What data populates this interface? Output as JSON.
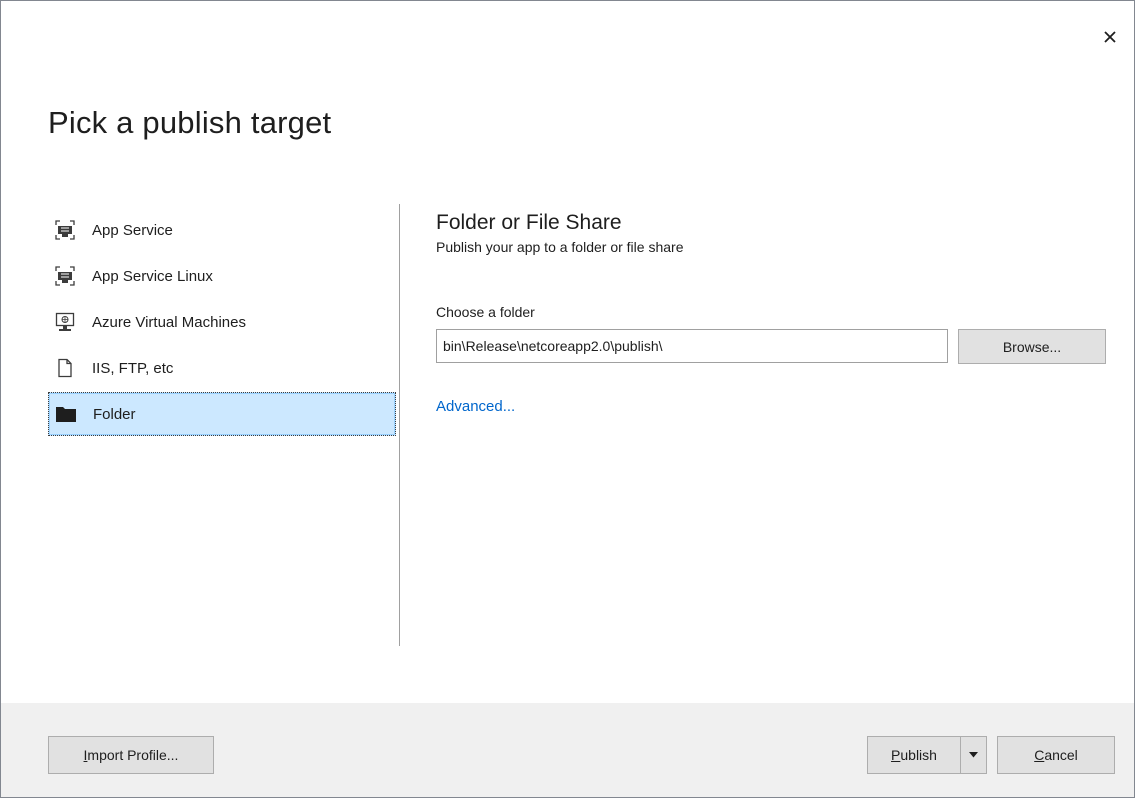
{
  "dialog": {
    "title": "Pick a publish target",
    "close_icon": "close-icon"
  },
  "targets": [
    {
      "label": "App Service",
      "icon": "app-service-icon",
      "selected": false
    },
    {
      "label": "App Service Linux",
      "icon": "app-service-linux-icon",
      "selected": false
    },
    {
      "label": "Azure Virtual Machines",
      "icon": "virtual-machine-icon",
      "selected": false
    },
    {
      "label": "IIS, FTP, etc",
      "icon": "document-icon",
      "selected": false
    },
    {
      "label": "Folder",
      "icon": "folder-icon",
      "selected": true
    }
  ],
  "detail": {
    "heading": "Folder or File Share",
    "subheading": "Publish your app to a folder or file share",
    "field_label": "Choose a folder",
    "folder_value": "bin\\Release\\netcoreapp2.0\\publish\\",
    "browse_label": "Browse...",
    "advanced_label": "Advanced..."
  },
  "footer": {
    "import_label_mnemonic": "I",
    "import_label_rest": "mport Profile...",
    "publish_label_mnemonic": "P",
    "publish_label_rest": "ublish",
    "cancel_label_mnemonic": "C",
    "cancel_label_rest": "ancel"
  },
  "colors": {
    "selection_bg": "#cce8ff",
    "link": "#0066cc",
    "footer_bg": "#f0f0f0"
  }
}
